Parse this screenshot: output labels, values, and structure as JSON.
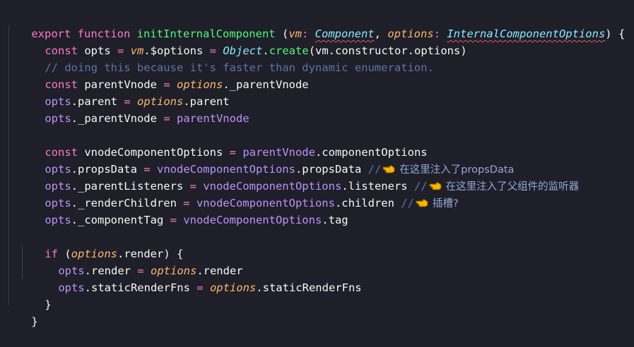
{
  "code": {
    "line1": {
      "kw_export": "export",
      "kw_function": "function",
      "fn_name": "initInternalComponent",
      "open": " (",
      "p_vm": "vm",
      "colon1": ": ",
      "t_component": "Component",
      "comma1": ", ",
      "p_options": "options",
      "colon2": ": ",
      "t_options": "InternalComponentOptions",
      "close": ") {"
    },
    "line2": {
      "kw_const": "const",
      "v_opts": " opts ",
      "eq": "=",
      "vm": " vm",
      "member": ".$options ",
      "eq2": "=",
      "obj": " Object",
      "dot": ".",
      "create": "create",
      "rest": "(vm.constructor.options)"
    },
    "line3": {
      "comment": "// doing this because it's faster than dynamic enumeration."
    },
    "line4": {
      "kw_const": "const",
      "v_name": " parentVnode ",
      "eq": "=",
      "options": " options",
      "rest": "._parentVnode"
    },
    "line5": {
      "opts": "opts",
      "member": ".parent ",
      "eq": "=",
      "options": " options",
      "rest": ".parent"
    },
    "line6": {
      "opts": "opts",
      "member": "._parentVnode ",
      "eq": "=",
      "value": " parentVnode"
    },
    "line8": {
      "kw_const": "const",
      "v_name": " vnodeComponentOptions ",
      "eq": "=",
      "value": " parentVnode",
      "rest": ".componentOptions"
    },
    "line9": {
      "opts": "opts",
      "member": ".propsData ",
      "eq": "=",
      "value": " vnodeComponentOptions",
      "rest": ".propsData ",
      "comment": "//",
      "note": "在这里注入了propsData"
    },
    "line10": {
      "opts": "opts",
      "member": "._parentListeners ",
      "eq": "=",
      "value": " vnodeComponentOptions",
      "rest": ".listeners ",
      "comment": "//",
      "note": "在这里注入了父组件的监听器"
    },
    "line11": {
      "opts": "opts",
      "member": "._renderChildren ",
      "eq": "=",
      "value": " vnodeComponentOptions",
      "rest": ".children ",
      "comment": "//",
      "note": "插槽?"
    },
    "line12": {
      "opts": "opts",
      "member": "._componentTag ",
      "eq": "=",
      "value": " vnodeComponentOptions",
      "rest": ".tag"
    },
    "line14": {
      "kw_if": "if",
      "open": " (",
      "options": "options",
      "rest": ".render) {"
    },
    "line15": {
      "opts": "opts",
      "member": ".render ",
      "eq": "=",
      "options": " options",
      "rest": ".render"
    },
    "line16": {
      "opts": "opts",
      "member": ".staticRenderFns ",
      "eq": "=",
      "options": " options",
      "rest": ".staticRenderFns"
    },
    "line17": {
      "brace": "}"
    },
    "line18": {
      "brace": "}"
    }
  },
  "icons": {
    "hand": "pointing-hand-icon"
  },
  "colors": {
    "background": "#1e1f29",
    "keyword": "#ff79c6",
    "function": "#50fa7b",
    "parameter": "#ffb86c",
    "type": "#8be9fd",
    "comment": "#6272a4",
    "variable": "#bd93f9",
    "text": "#f8f8f2"
  }
}
